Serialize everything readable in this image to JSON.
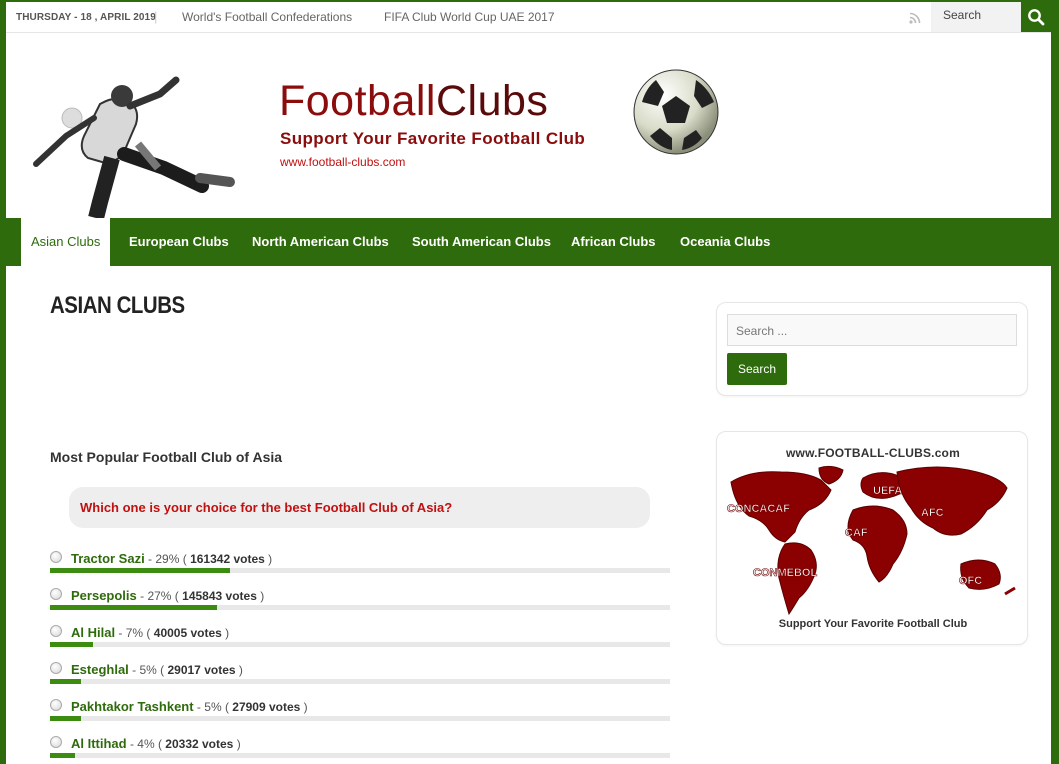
{
  "topbar": {
    "date": "THURSDAY - 18 , APRIL 2019",
    "links": [
      "World's Football Confederations",
      "FIFA Club World Cup UAE 2017"
    ],
    "search_placeholder": "Search",
    "rss_icon": "rss-icon",
    "search_icon": "search-icon"
  },
  "header": {
    "logo_word1": "Football",
    "logo_word2": "Clubs",
    "tagline": "Support Your Favorite Football Club",
    "url": "www.football-clubs.com"
  },
  "nav": {
    "items": [
      "Asian Clubs",
      "European Clubs",
      "North American Clubs",
      "South American Clubs",
      "African Clubs",
      "Oceania Clubs"
    ],
    "active": "Asian Clubs"
  },
  "main": {
    "title": "ASIAN CLUBS",
    "section_heading": "Most Popular Football Club of Asia",
    "question": "Which one is your choice for the best Football Club of Asia?",
    "poll": [
      {
        "club": "Tractor Sazi",
        "percent_text": "29%",
        "votes": "161342 votes",
        "percent": 29
      },
      {
        "club": "Persepolis",
        "percent_text": "27%",
        "votes": "145843 votes",
        "percent": 27
      },
      {
        "club": "Al Hilal",
        "percent_text": "7%",
        "votes": "40005 votes",
        "percent": 7
      },
      {
        "club": "Esteghlal",
        "percent_text": "5%",
        "votes": "29017 votes",
        "percent": 5
      },
      {
        "club": "Pakhtakor Tashkent",
        "percent_text": "5%",
        "votes": "27909 votes",
        "percent": 5
      },
      {
        "club": "Al Ittihad",
        "percent_text": "4%",
        "votes": "20332 votes",
        "percent": 4
      }
    ]
  },
  "sidebar": {
    "search_placeholder": "Search ...",
    "search_button": "Search",
    "map_url": "www.FOOTBALL-CLUBS.com",
    "map_caption": "Support Your Favorite Football Club",
    "map_labels": [
      "CONCACAF",
      "UEFA",
      "AFC",
      "CAF",
      "CONMEBOL",
      "OFC"
    ]
  },
  "colors": {
    "brand_green": "#2e6b0c",
    "logo_red": "#8a0c0c",
    "question_red": "#c01010",
    "map_red": "#8b0000"
  }
}
